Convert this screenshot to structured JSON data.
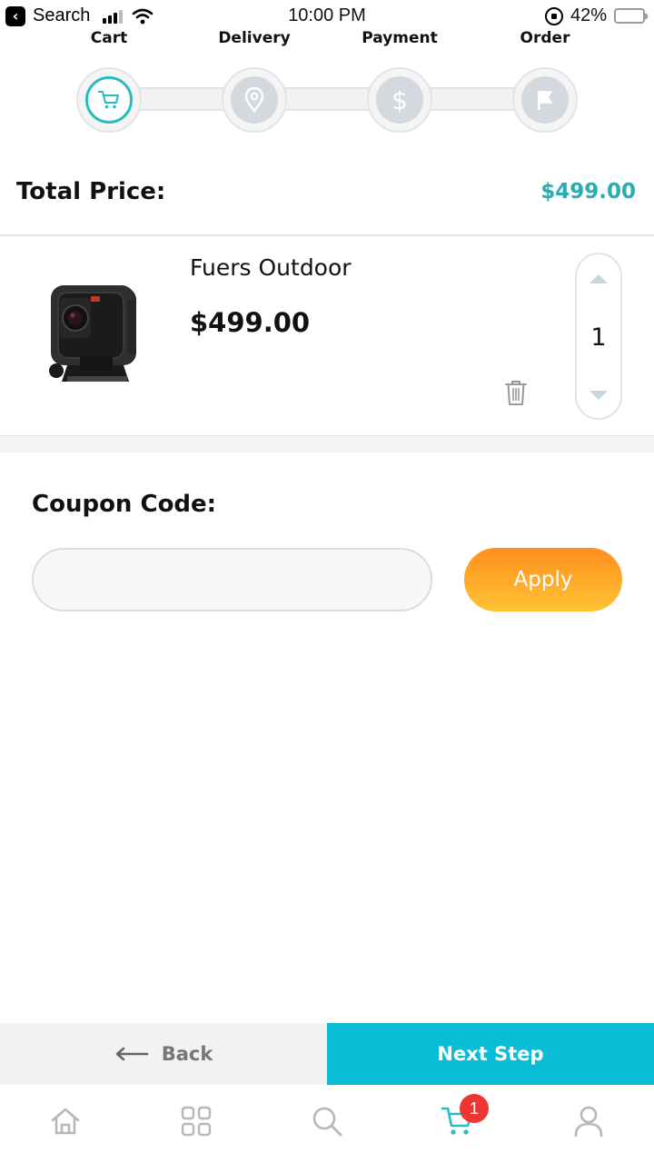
{
  "status_bar": {
    "back_label": "Search",
    "time": "10:00 PM",
    "battery": "42%",
    "battery_level": 0.42
  },
  "stepper": {
    "steps": [
      {
        "label": "Cart",
        "icon": "cart-icon",
        "active": true
      },
      {
        "label": "Delivery",
        "icon": "location-pin-icon",
        "active": false
      },
      {
        "label": "Payment",
        "icon": "dollar-icon",
        "active": false
      },
      {
        "label": "Order",
        "icon": "flag-icon",
        "active": false
      }
    ]
  },
  "total": {
    "label": "Total Price:",
    "value": "$499.00"
  },
  "cart_items": [
    {
      "name": "Fuers Outdoor",
      "price": "$499.00",
      "quantity": "1",
      "image": "action-camera-image"
    }
  ],
  "coupon": {
    "label": "Coupon Code:",
    "value": "",
    "apply_label": "Apply"
  },
  "actions": {
    "back_label": "Back",
    "next_label": "Next Step"
  },
  "tab_bar": {
    "items": [
      "home-icon",
      "grid-icon",
      "search-icon",
      "cart-icon",
      "user-icon"
    ],
    "active": "cart-icon",
    "cart_badge": "1"
  },
  "colors": {
    "accent": "#26BDC0",
    "next_button": "#0BBCD6",
    "apply_gradient_top": "#FF8F1F",
    "apply_gradient_bottom": "#FFC233",
    "badge": "#EF3434"
  }
}
